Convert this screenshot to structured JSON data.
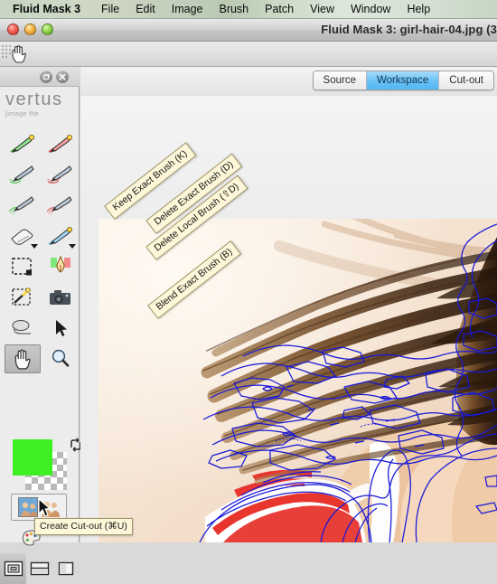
{
  "menubar": {
    "items": [
      {
        "label": "Fluid Mask 3",
        "app": true
      },
      {
        "label": "File"
      },
      {
        "label": "Edit"
      },
      {
        "label": "Image"
      },
      {
        "label": "Brush"
      },
      {
        "label": "Patch"
      },
      {
        "label": "View"
      },
      {
        "label": "Window"
      },
      {
        "label": "Help"
      }
    ]
  },
  "window": {
    "title": "Fluid Mask 3: girl-hair-04.jpg (3",
    "traffic_lights": [
      "close-button",
      "minimize-button",
      "zoom-button"
    ]
  },
  "left_panel": {
    "header_buttons": [
      "restore-panel-button",
      "close-panel-button"
    ],
    "logo": {
      "wordmark": "vertus",
      "tagline": "[image the"
    },
    "tools": [
      {
        "name": "keep-exact-brush-tool",
        "row": 0,
        "col": 0,
        "selected": false
      },
      {
        "name": "delete-exact-brush-tool",
        "row": 0,
        "col": 1,
        "selected": false
      },
      {
        "name": "keep-local-brush-tool",
        "row": 1,
        "col": 0,
        "selected": false
      },
      {
        "name": "delete-local-brush-tool",
        "row": 1,
        "col": 1,
        "selected": false
      },
      {
        "name": "keep-blend-brush-tool",
        "row": 2,
        "col": 0,
        "selected": false
      },
      {
        "name": "delete-blend-brush-tool",
        "row": 2,
        "col": 1,
        "selected": false
      },
      {
        "name": "eraser-tool",
        "row": 3,
        "col": 0,
        "selected": false
      },
      {
        "name": "blend-exact-brush-tool",
        "row": 3,
        "col": 1,
        "selected": false
      },
      {
        "name": "marquee-select-tool",
        "row": 4,
        "col": 0,
        "selected": false
      },
      {
        "name": "blend-pen-tool",
        "row": 4,
        "col": 1,
        "selected": false
      },
      {
        "name": "magic-wand-tool",
        "row": 5,
        "col": 0,
        "selected": false
      },
      {
        "name": "camera-snapshot-tool",
        "row": 5,
        "col": 1,
        "selected": false
      },
      {
        "name": "blob-brush-tool",
        "row": 6,
        "col": 0,
        "selected": false
      },
      {
        "name": "pointer-tool",
        "row": 6,
        "col": 1,
        "selected": false
      },
      {
        "name": "hand-pan-tool",
        "row": 7,
        "col": 0,
        "selected": true
      },
      {
        "name": "zoom-tool",
        "row": 7,
        "col": 1,
        "selected": false
      }
    ],
    "swatch": {
      "foreground_color": "#3cf021",
      "background_label": "transparent-checkerboard",
      "swap_icon": "swap-colors-icon"
    },
    "cutout_button": {
      "name": "create-cutout-button"
    },
    "palette_icon": "color-palette-icon",
    "view_modes": [
      {
        "name": "view-mode-single",
        "selected": true
      },
      {
        "name": "view-mode-split-horizontal",
        "selected": false
      },
      {
        "name": "view-mode-side-by-side",
        "selected": false
      }
    ]
  },
  "tooltips": [
    {
      "name": "tooltip-keep-exact-brush",
      "text": "Keep Exact Brush (K)"
    },
    {
      "name": "tooltip-delete-exact-brush",
      "text": "Delete Exact Brush (D)"
    },
    {
      "name": "tooltip-delete-local-brush",
      "text": "Delete Local Brush (⇧D)"
    },
    {
      "name": "tooltip-blend-exact-brush",
      "text": "Blend Exact Brush (B)"
    },
    {
      "name": "tooltip-create-cutout",
      "text": "Create Cut-out (⌘U)"
    }
  ],
  "tabs": [
    {
      "label": "Source",
      "active": false
    },
    {
      "label": "Workspace",
      "active": true
    },
    {
      "label": "Cut-out",
      "active": false
    }
  ],
  "canvas": {
    "name": "image-canvas",
    "subject": "girl with windblown hair, red-and-white striped top",
    "mask_outline_color": "#1818d8",
    "background_color": "#f6ece0"
  },
  "colors": {
    "menubar_tint": "#c9d6c4",
    "accent_tab": "#53b6f3",
    "swatch_green": "#3cf021",
    "tooltip_bg": "#fdf6d8",
    "mask_blue": "#1818d8"
  }
}
